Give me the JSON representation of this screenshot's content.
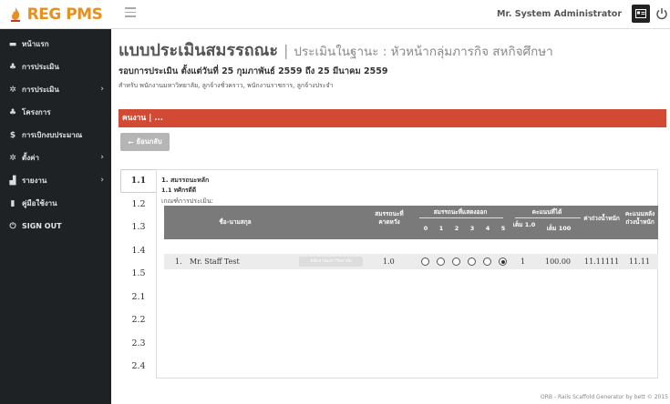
{
  "brand": {
    "name": "REG PMS"
  },
  "header": {
    "user": "Mr. System Administrator"
  },
  "sidebar": {
    "items": [
      {
        "icon": "home-icon",
        "label": "หน้าแรก",
        "chevron": false
      },
      {
        "icon": "users-icon",
        "label": "การประเมิน",
        "chevron": false
      },
      {
        "icon": "gears-icon",
        "label": "การประเมิน",
        "chevron": true
      },
      {
        "icon": "users-icon",
        "label": "โครงการ",
        "chevron": false
      },
      {
        "icon": "dollar-icon",
        "label": "การเบิกงบประมาณ",
        "chevron": false
      },
      {
        "icon": "gears-icon",
        "label": "ตั้งค่า",
        "chevron": true
      },
      {
        "icon": "chart-icon",
        "label": "รายงาน",
        "chevron": true
      },
      {
        "icon": "book-icon",
        "label": "คู่มือใช้งาน",
        "chevron": false
      },
      {
        "icon": "power-icon",
        "label": "SIGN OUT",
        "chevron": false
      }
    ]
  },
  "page": {
    "title": "แบบประเมินสมรรถณะ",
    "separator": "|",
    "subtitle": "ประเมินในฐานะ : หัวหน้ากลุ่มภารกิจ สหกิจศึกษา",
    "round": "รอบการประเมิน ตั้งแต่วันที่ 25 กุมภาพันธ์ 2559 ถึง 25 มีนาคม 2559",
    "for": "สำหรับ พนักงานมหาวิทยาลัย, ลูกจ้างชั่วคราว, พนักงานราชการ, ลูกจ้างประจำ"
  },
  "panel": {
    "heading": "คนงาน | ...",
    "back_label": "ย้อนกลับ"
  },
  "tabs": [
    "1.1",
    "1.2",
    "1.3",
    "1.4",
    "1.5",
    "2.1",
    "2.2",
    "2.3",
    "2.4"
  ],
  "criteria": {
    "title": "1. สมรรถนะหลัก",
    "subtitle": "1.1 ทศิกรดีดี",
    "label": "เกณฑ์การประเมิน:"
  },
  "table": {
    "headers": {
      "name": "ชื่อ-นามสกุล",
      "expected": "สมรรถนะที่คาดหวัง",
      "displayed": "สมรรถนะที่แสดงออก",
      "levels": [
        "0",
        "1",
        "2",
        "3",
        "4",
        "5"
      ],
      "score": "คะแนนที่ได้",
      "full1": "เต็ม 1.0",
      "full100": "เต็ม 100",
      "weight": "ค่าถ่วงน้ำหนัก",
      "weighted": "คะแนนหลังถ่วงน้ำหนัก"
    },
    "rows": [
      {
        "index": "1.",
        "name": "Mr. Staff Test",
        "position": "พนักงานมหาวิทยาลัย",
        "expected": "1.0",
        "selected_level": 5,
        "score1": "1",
        "score100": "100.00",
        "weight": "11.11111",
        "weighted": "11.11"
      }
    ]
  },
  "footer": {
    "text": "ORB - Rails Scaffold Generator by bett © 2015"
  }
}
